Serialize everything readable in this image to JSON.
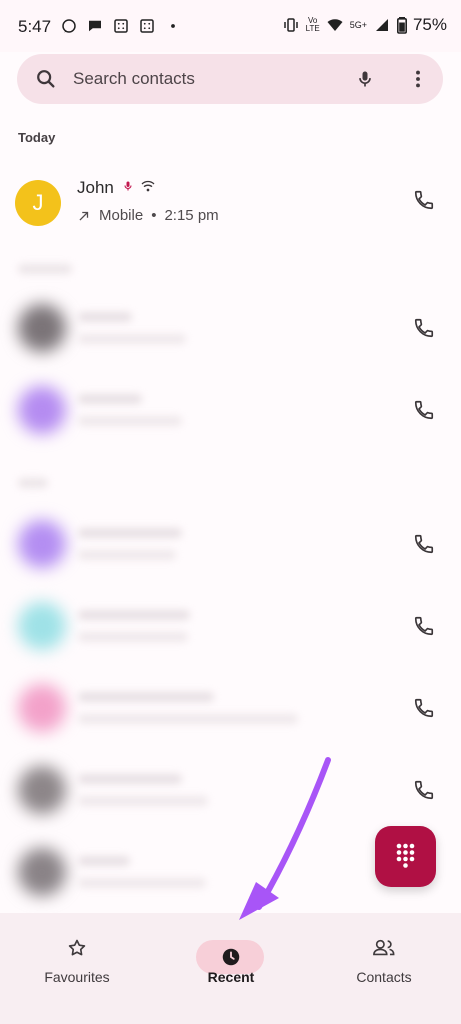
{
  "status": {
    "time": "5:47",
    "battery": "75%",
    "volte_label": "Vo\nLTE",
    "network": "5G+"
  },
  "search": {
    "placeholder": "Search contacts"
  },
  "sections": {
    "today": "Today"
  },
  "recent_call": {
    "avatar_letter": "J",
    "name": "John",
    "call_type": "Mobile",
    "time": "2:15 pm"
  },
  "nav": {
    "favourites": "Favourites",
    "recent": "Recent",
    "contacts": "Contacts"
  },
  "colors": {
    "accent": "#b01044",
    "active_pill": "#f7cfd8",
    "search_bg": "#f6e1e8",
    "avatar_john": "#f3c21b",
    "arrow": "#a855f7"
  },
  "icons": {
    "search": "search-icon",
    "mic": "microphone-icon",
    "more": "more-vert-icon",
    "phone": "phone-icon",
    "favourites": "star-icon",
    "recent": "clock-icon",
    "contacts": "people-icon",
    "dialpad": "dialpad-icon",
    "outgoing": "outgoing-call-icon"
  }
}
